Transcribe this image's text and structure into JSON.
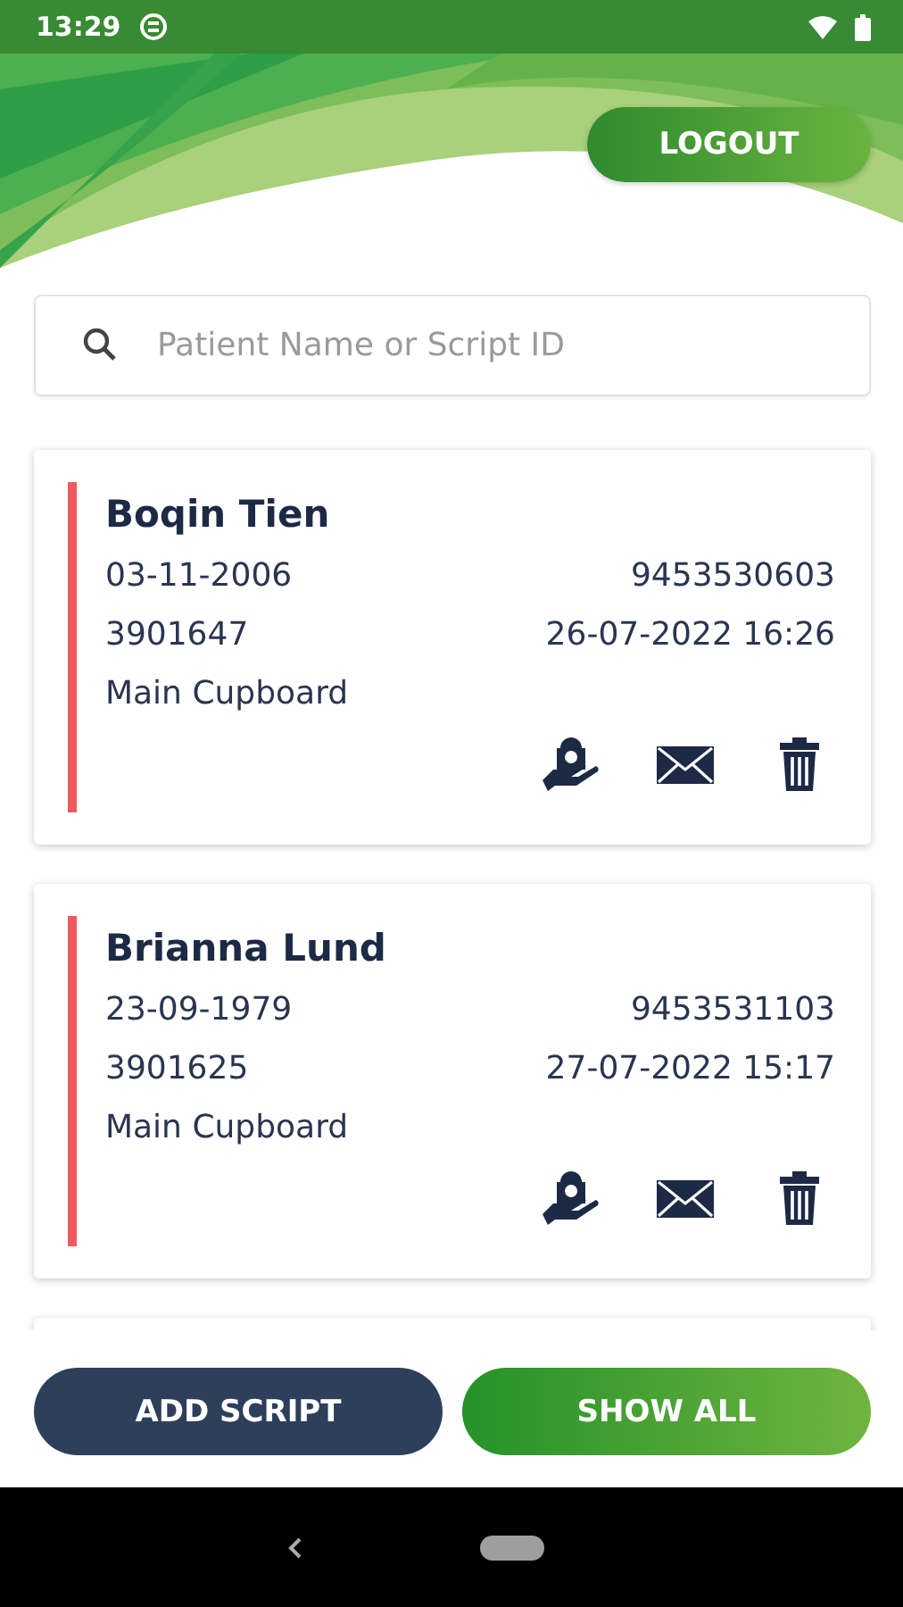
{
  "status_bar": {
    "time": "13:29"
  },
  "header": {
    "logout": "LOGOUT"
  },
  "search": {
    "placeholder": "Patient Name or Script ID"
  },
  "scripts": [
    {
      "name": "Boqin Tien",
      "dob": "03-11-2006",
      "phone": "9453530603",
      "script_id": "3901647",
      "datetime": "26-07-2022 16:26",
      "location": "Main Cupboard",
      "color": "#ef5a5e"
    },
    {
      "name": "Brianna Lund",
      "dob": "23-09-1979",
      "phone": "9453531103",
      "script_id": "3901625",
      "datetime": "27-07-2022 15:17",
      "location": "Main Cupboard",
      "color": "#ef5a5e"
    }
  ],
  "buttons": [
    {
      "label": "ADD SCRIPT",
      "kind": "secondary"
    },
    {
      "label": "SHOW ALL",
      "kind": "primary"
    }
  ]
}
